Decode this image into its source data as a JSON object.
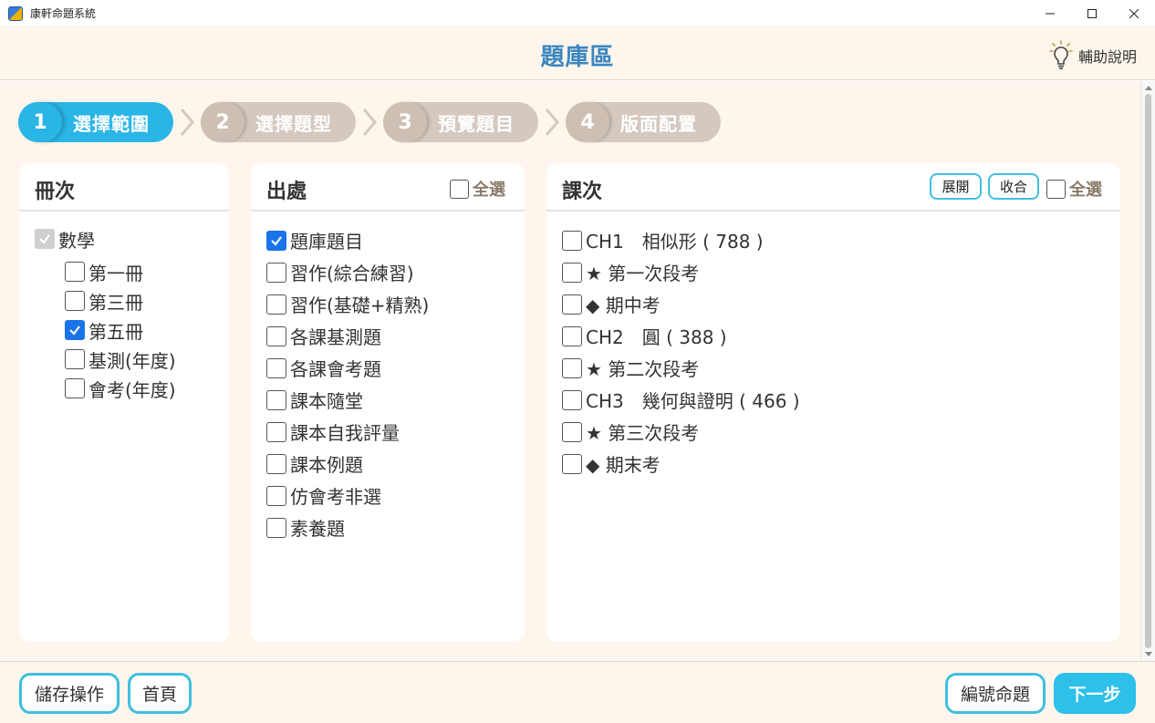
{
  "window": {
    "title": "康軒命題系統"
  },
  "header": {
    "title": "題庫區",
    "help_label": "輔助說明"
  },
  "steps": [
    {
      "num": "1",
      "label": "選擇範圍",
      "active": true
    },
    {
      "num": "2",
      "label": "選擇題型",
      "active": false
    },
    {
      "num": "3",
      "label": "預覽題目",
      "active": false
    },
    {
      "num": "4",
      "label": "版面配置",
      "active": false
    }
  ],
  "volumes_panel": {
    "title": "冊次",
    "root": {
      "label": "數學",
      "checked": true,
      "disabled": true
    },
    "items": [
      {
        "label": "第一冊",
        "checked": false
      },
      {
        "label": "第三冊",
        "checked": false
      },
      {
        "label": "第五冊",
        "checked": true
      },
      {
        "label": "基測(年度)",
        "checked": false
      },
      {
        "label": "會考(年度)",
        "checked": false
      }
    ]
  },
  "sources_panel": {
    "title": "出處",
    "select_all_label": "全選",
    "items": [
      {
        "label": "題庫題目",
        "checked": true
      },
      {
        "label": "習作(綜合練習)",
        "checked": false
      },
      {
        "label": "習作(基礎+精熟)",
        "checked": false
      },
      {
        "label": "各課基測題",
        "checked": false
      },
      {
        "label": "各課會考題",
        "checked": false
      },
      {
        "label": "課本隨堂",
        "checked": false
      },
      {
        "label": "課本自我評量",
        "checked": false
      },
      {
        "label": "課本例題",
        "checked": false
      },
      {
        "label": "仿會考非選",
        "checked": false
      },
      {
        "label": "素養題",
        "checked": false
      }
    ]
  },
  "lessons_panel": {
    "title": "課次",
    "expand_label": "展開",
    "collapse_label": "收合",
    "select_all_label": "全選",
    "items": [
      {
        "label": "CH1　相似形 ( 788 )",
        "checked": false
      },
      {
        "label": "★ 第一次段考",
        "checked": false
      },
      {
        "label": "◆ 期中考",
        "checked": false
      },
      {
        "label": "CH2　圓 ( 388 )",
        "checked": false
      },
      {
        "label": "★ 第二次段考",
        "checked": false
      },
      {
        "label": "CH3　幾何與證明 ( 466 )",
        "checked": false
      },
      {
        "label": "★ 第三次段考",
        "checked": false
      },
      {
        "label": "◆ 期末考",
        "checked": false
      }
    ]
  },
  "footer": {
    "save_label": "儲存操作",
    "home_label": "首頁",
    "number_label": "編號命題",
    "next_label": "下一步"
  },
  "colors": {
    "accent": "#29b5e6",
    "title_blue": "#3b87c0",
    "step_inactive": "#d5c9bf",
    "background": "#fef6ec"
  }
}
